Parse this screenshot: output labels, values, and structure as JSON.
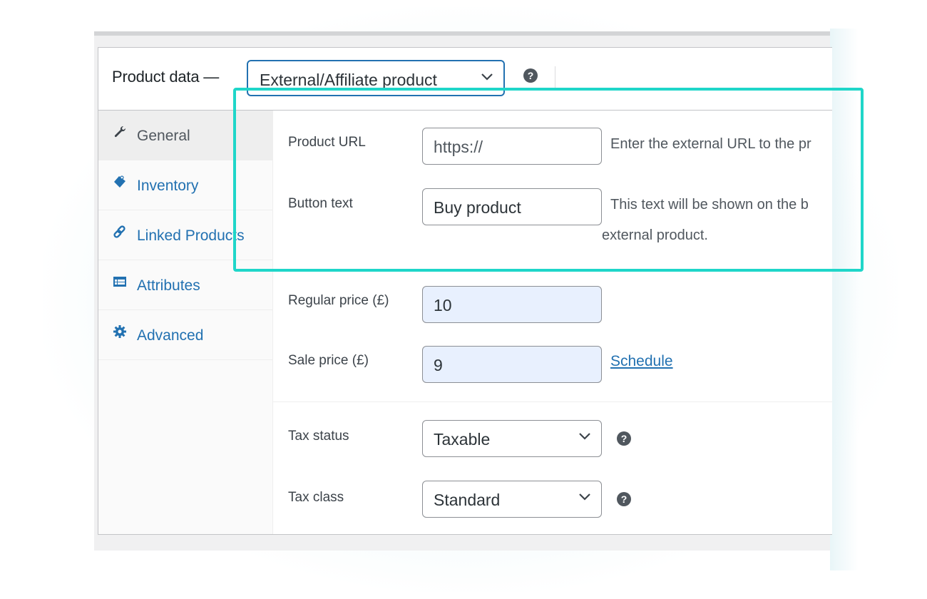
{
  "header": {
    "title": "Product data —",
    "product_type": "External/Affiliate product",
    "help_icon": "question-circle-icon"
  },
  "sidebar": {
    "items": [
      {
        "label": "General",
        "icon": "wrench-icon",
        "active": true
      },
      {
        "label": "Inventory",
        "icon": "tag-icon",
        "active": false
      },
      {
        "label": "Linked Products",
        "icon": "link-icon",
        "active": false
      },
      {
        "label": "Attributes",
        "icon": "list-table-icon",
        "active": false
      },
      {
        "label": "Advanced",
        "icon": "gear-icon",
        "active": false
      }
    ]
  },
  "general": {
    "product_url": {
      "label": "Product URL",
      "placeholder": "https://",
      "value": "",
      "description": "Enter the external URL to the pr"
    },
    "button_text": {
      "label": "Button text",
      "value": "Buy product",
      "description_line1": "This text will be shown on the b",
      "description_line2": "external product."
    },
    "regular_price": {
      "label": "Regular price (£)",
      "value": "10"
    },
    "sale_price": {
      "label": "Sale price (£)",
      "value": "9",
      "schedule_link": "Schedule"
    },
    "tax_status": {
      "label": "Tax status",
      "value": "Taxable"
    },
    "tax_class": {
      "label": "Tax class",
      "value": "Standard"
    }
  },
  "colors": {
    "accent": "#2271b1",
    "highlight": "#1fd6c9",
    "filled_input": "#e8f0fe"
  }
}
